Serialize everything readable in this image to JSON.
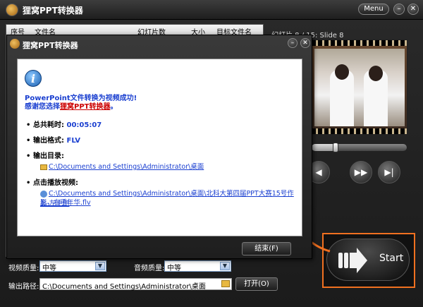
{
  "app": {
    "title": "狸窝PPT转换器",
    "menu_label": "Menu"
  },
  "list": {
    "headers": [
      "序号",
      "文件名",
      "幻灯片数",
      "大小",
      "目标文件名"
    ]
  },
  "preview": {
    "label": "幻灯片 8 / 15: Slide 8",
    "seek_fraction": 0.25
  },
  "controls": {
    "prev_icon": "previous-icon",
    "next_icon": "fast-forward-icon",
    "end_icon": "skip-end-icon"
  },
  "bottom": {
    "video_quality_label": "视频质量:",
    "video_quality_value": "中等",
    "audio_quality_label": "音频质量:",
    "audio_quality_value": "中等",
    "output_path_label": "输出路径:",
    "output_path_value": "C:\\Documents and Settings\\Administrator\\桌面",
    "open_button": "打开(O)"
  },
  "start_button": {
    "label": "Start"
  },
  "dialog": {
    "title": "狸窝PPT转换器",
    "success": "PowerPoint文件转换为视频成功!",
    "thanks_prefix": "感谢您选择",
    "thanks_brand": "狸窝PPT转换器",
    "thanks_suffix": "。",
    "total_time_label": "总共耗时:",
    "total_time_value": "00:05:07",
    "format_label": "输出格式:",
    "format_value": "FLV",
    "dir_label": "输出目录:",
    "dir_value": "C:\\Documents and Settings\\Administrator\\桌面",
    "play_label": "点击播放视频:",
    "play_value_1": "C:\\Documents and Settings\\Administrator\\桌面\\北科大第四届PPT大赛15号作品-左手倒",
    "play_value_2": "影，右手年华.flv",
    "finish_button": "结束(F)"
  }
}
